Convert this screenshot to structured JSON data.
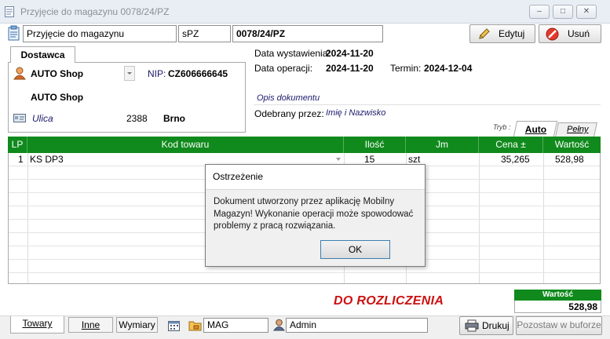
{
  "window": {
    "title": "Przyjęcie do magazynu 0078/24/PZ",
    "minimize_glyph": "–",
    "maximize_glyph": "□",
    "close_glyph": "✕"
  },
  "toolbar": {
    "doc_type": "Przyjęcie do magazynu",
    "series": "sPZ",
    "doc_number": "0078/24/PZ",
    "edit_label": "Edytuj",
    "delete_label": "Usuń"
  },
  "supplier": {
    "tab_label": "Dostawca",
    "name": "AUTO Shop",
    "nip_label": "NIP:",
    "nip_value": "CZ606666645",
    "full_name": "AUTO Shop",
    "street": "Ulica",
    "postcode": "2388",
    "city": "Brno"
  },
  "dates": {
    "issue_label": "Data wystawienia:",
    "issue_value": "2024-11-20",
    "operation_label": "Data operacji:",
    "operation_value": "2024-11-20",
    "term_label": "Termin:",
    "term_value": "2024-12-04"
  },
  "description_placeholder": "Opis dokumentu",
  "received_by": {
    "label": "Odebrany przez:",
    "value": "Imię i Nazwisko"
  },
  "mode_tabs": {
    "label": "Tryb :",
    "auto": "Auto",
    "full": "Pełny"
  },
  "table": {
    "columns": [
      "LP",
      "Kod towaru",
      "Ilość",
      "Jm",
      "Cena ±",
      "Wartość"
    ],
    "rows": [
      {
        "lp": "1",
        "code": "KS DP3",
        "qty": "15",
        "unit": "szt",
        "price": "35,265",
        "value": "528,98"
      }
    ]
  },
  "dialog": {
    "title": "Ostrzeżenie",
    "message": "Dokument utworzony przez aplikację Mobilny Magazyn! Wykonanie operacji może spowodować problemy z pracą rozwiązania.",
    "ok_label": "OK"
  },
  "status_text": "DO ROZLICZENIA",
  "total": {
    "label": "Wartość",
    "value": "528,98"
  },
  "bottom": {
    "tab_goods": "Towary",
    "tab_other": "Inne",
    "tab_dimensions": "Wymiary",
    "warehouse": "MAG",
    "user": "Admin",
    "print_label": "Drukuj",
    "buffer_label": "Pozostaw w buforze"
  },
  "colors": {
    "grid_header": "#108a1c",
    "status_red": "#cc1111",
    "navy_text": "#1c1a6b"
  }
}
